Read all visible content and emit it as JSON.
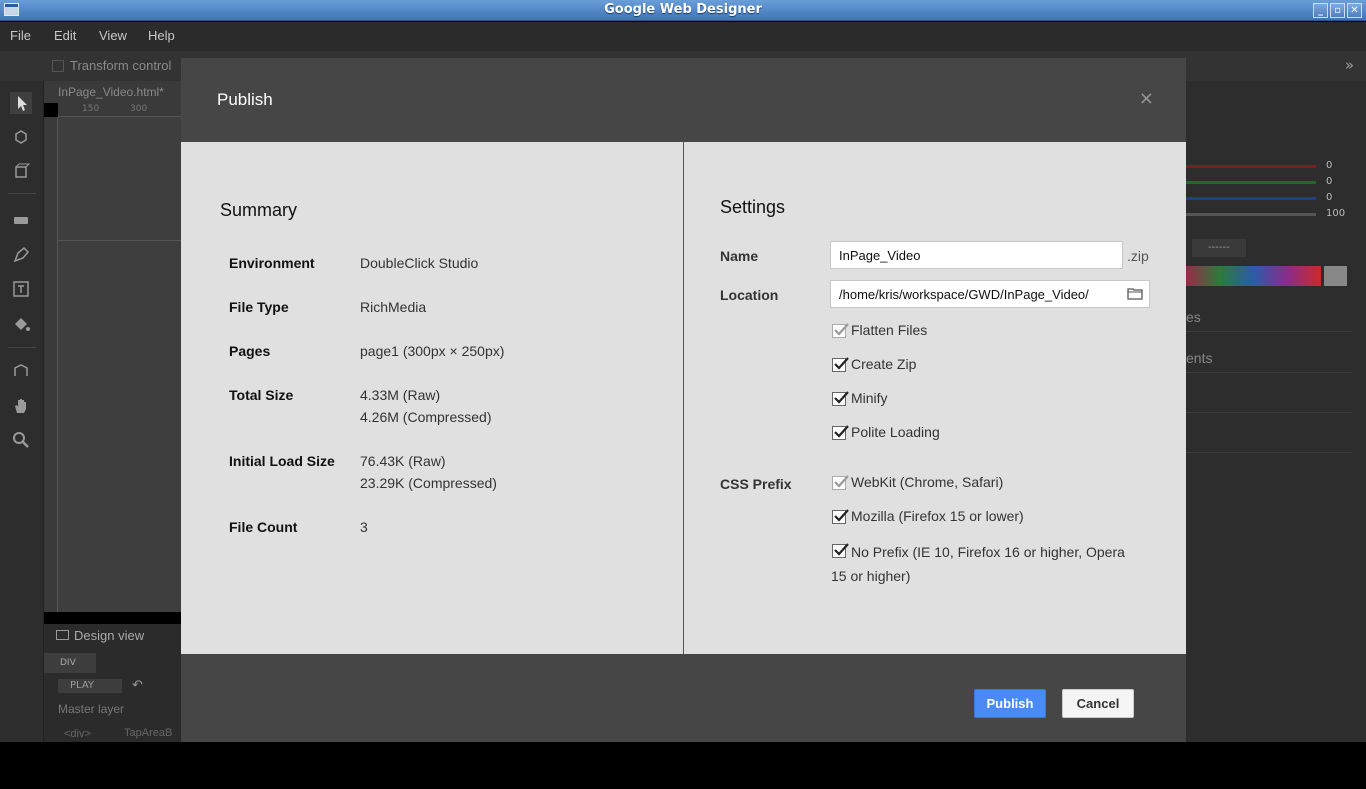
{
  "window": {
    "title": "Google Web Designer",
    "controls": [
      "_",
      "▫",
      "✕"
    ]
  },
  "menu": [
    "File",
    "Edit",
    "View",
    "Help"
  ],
  "toolbar": {
    "transform_control": "Transform control",
    "expand_icon": "»"
  },
  "tools": [
    "selection-tool",
    "3d-object-tool",
    "3d-rotation-tool",
    "tag-tool",
    "pen-tool",
    "text-tool",
    "fill-tool",
    "3d-translation-tool",
    "hand-tool",
    "zoom-tool"
  ],
  "document": {
    "tab": "InPage_Video.html*",
    "ruler_labels": [
      "150",
      "300"
    ]
  },
  "bottom_panel": {
    "design_view": "Design view",
    "element_tag": "DIV",
    "play": "PLAY",
    "master_layer": "Master layer",
    "div_tag": "<div>",
    "tap_area": "TapAreaB"
  },
  "right_panel": {
    "slider_values": [
      "0",
      "0",
      "0",
      "100"
    ],
    "hex_field": "------",
    "rows": [
      "es",
      "ents"
    ]
  },
  "dialog": {
    "title": "Publish",
    "close": "×",
    "summary": {
      "title": "Summary",
      "rows": [
        {
          "label": "Environment",
          "value": [
            "DoubleClick Studio"
          ]
        },
        {
          "label": "File Type",
          "value": [
            "RichMedia"
          ]
        },
        {
          "label": "Pages",
          "value": [
            "page1 (300px × 250px)"
          ]
        },
        {
          "label": "Total Size",
          "value": [
            "4.33M (Raw)",
            "4.26M (Compressed)"
          ]
        },
        {
          "label": "Initial Load Size",
          "value": [
            "76.43K (Raw)",
            "23.29K (Compressed)"
          ]
        },
        {
          "label": "File Count",
          "value": [
            "3"
          ]
        }
      ]
    },
    "settings": {
      "title": "Settings",
      "name_label": "Name",
      "name_value": "InPage_Video",
      "name_suffix": ".zip",
      "location_label": "Location",
      "location_value": "/home/kris/workspace/GWD/InPage_Video/",
      "options": [
        {
          "label": "Flatten Files",
          "checked": true,
          "disabled": true
        },
        {
          "label": "Create Zip",
          "checked": true,
          "disabled": false
        },
        {
          "label": "Minify",
          "checked": true,
          "disabled": false
        },
        {
          "label": "Polite Loading",
          "checked": true,
          "disabled": false
        }
      ],
      "css_prefix_label": "CSS Prefix",
      "css_prefixes": [
        {
          "label": "WebKit (Chrome, Safari)",
          "checked": true,
          "disabled": true
        },
        {
          "label": "Mozilla (Firefox 15 or lower)",
          "checked": true,
          "disabled": false
        },
        {
          "label": "No Prefix (IE 10, Firefox 16 or higher, Opera 15 or higher)",
          "checked": true,
          "disabled": false
        }
      ]
    },
    "buttons": {
      "publish": "Publish",
      "cancel": "Cancel"
    }
  },
  "colors": {
    "accent": "#4a8af4",
    "modal_body": "#e0e0e0",
    "modal_chrome": "#464646"
  }
}
